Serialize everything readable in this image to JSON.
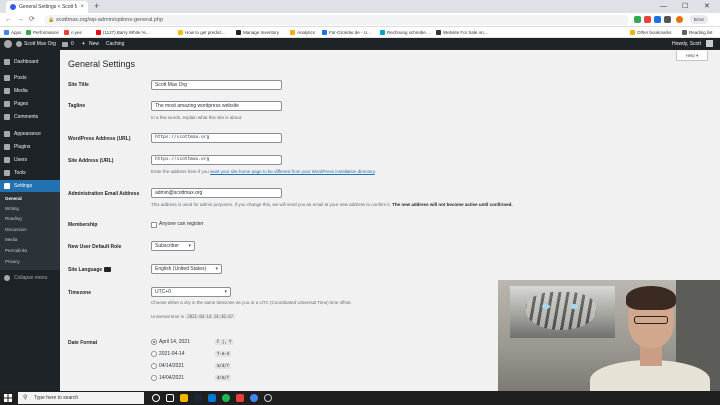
{
  "browser": {
    "tab_title": "General Settings < Scott Max O",
    "tab_close": "×",
    "new_tab": "+",
    "url": "scottmax.org/wp-admin/options-general.php",
    "nav_back": "←",
    "nav_forward": "→",
    "nav_reload": "⟳",
    "lock": "🔒",
    "profile_label": "Error",
    "min": "—",
    "max": "☐",
    "close": "✕"
  },
  "bookmarks": [
    {
      "label": "Apps",
      "color": "#4285f4"
    },
    {
      "label": "Performance",
      "color": "#34a853"
    },
    {
      "label": "c-yes",
      "color": "#ea4335"
    },
    {
      "label": "(1127) Barry White %…",
      "color": "#ff0000"
    },
    {
      "label": "How to get predict…",
      "color": "#fbbc05"
    },
    {
      "label": "Manage Inventory",
      "color": "#222222"
    },
    {
      "label": "Analytics",
      "color": "#f9ab00"
    },
    {
      "label": "Für-Gründer.de - U…",
      "color": "#1a73e8"
    },
    {
      "label": "Rechnung schreibe…",
      "color": "#00a0d2"
    },
    {
      "label": "Website For Sale on…",
      "color": "#333333"
    },
    {
      "label": "Other bookmarks",
      "color": "#f4b400"
    },
    {
      "label": "Reading list",
      "color": "#5f6368"
    }
  ],
  "adminbar": {
    "site_name": "Scott Max Org",
    "comments_count": "0",
    "new_label": "New",
    "caching": "Caching",
    "greeting": "Howdy, Scott"
  },
  "sidebar": {
    "items": [
      {
        "label": "Dashboard"
      },
      {
        "label": "Posts"
      },
      {
        "label": "Media"
      },
      {
        "label": "Pages"
      },
      {
        "label": "Comments"
      },
      {
        "label": "Appearance"
      },
      {
        "label": "Plugins"
      },
      {
        "label": "Users"
      },
      {
        "label": "Tools"
      },
      {
        "label": "Settings"
      }
    ],
    "submenu": [
      "General",
      "Writing",
      "Reading",
      "Discussion",
      "Media",
      "Permalinks",
      "Privacy"
    ],
    "collapse": "Collapse menu"
  },
  "page": {
    "title": "General Settings",
    "help": "Help ▾"
  },
  "form": {
    "site_title_label": "Site Title",
    "site_title_value": "Scott Max Org",
    "tagline_label": "Tagline",
    "tagline_value": "The most amazing wordpress website",
    "tagline_desc": "In a few words, explain what this site is about.",
    "wp_address_label": "WordPress Address (URL)",
    "wp_address_value": "https://scottmax.org",
    "site_address_label": "Site Address (URL)",
    "site_address_value": "https://scottmax.org",
    "site_address_desc_pre": "Enter the address here if you ",
    "site_address_desc_link": "want your site home page to be different from your WordPress installation directory",
    "site_address_desc_post": ".",
    "admin_email_label": "Administration Email Address",
    "admin_email_value": "admin@scottmax.org",
    "admin_email_desc": "This address is used for admin purposes. If you change this, we will send you an email at your new address to confirm it. ",
    "admin_email_desc_bold": "The new address will not become active until confirmed.",
    "membership_label": "Membership",
    "membership_check": "Anyone can register",
    "default_role_label": "New User Default Role",
    "default_role_value": "Subscriber",
    "language_label": "Site Language",
    "language_value": "English (United States)",
    "timezone_label": "Timezone",
    "timezone_value": "UTC+0",
    "timezone_desc": "Choose either a city in the same timezone as you or a UTC (Coordinated Universal Time) time offset.",
    "universal_time_label": "Universal time is",
    "universal_time_value": "2021-04-14 14:36:47",
    "date_format_label": "Date Format",
    "date_formats": [
      {
        "label": "April 14, 2021",
        "code": "F j, Y"
      },
      {
        "label": "2021-04-14",
        "code": "Y-m-d"
      },
      {
        "label": "04/14/2021",
        "code": "m/d/Y"
      },
      {
        "label": "14/04/2021",
        "code": "d/m/Y"
      }
    ],
    "caret": "▾"
  },
  "taskbar": {
    "search_placeholder": "Type here to search",
    "search_icon": "⚲"
  }
}
